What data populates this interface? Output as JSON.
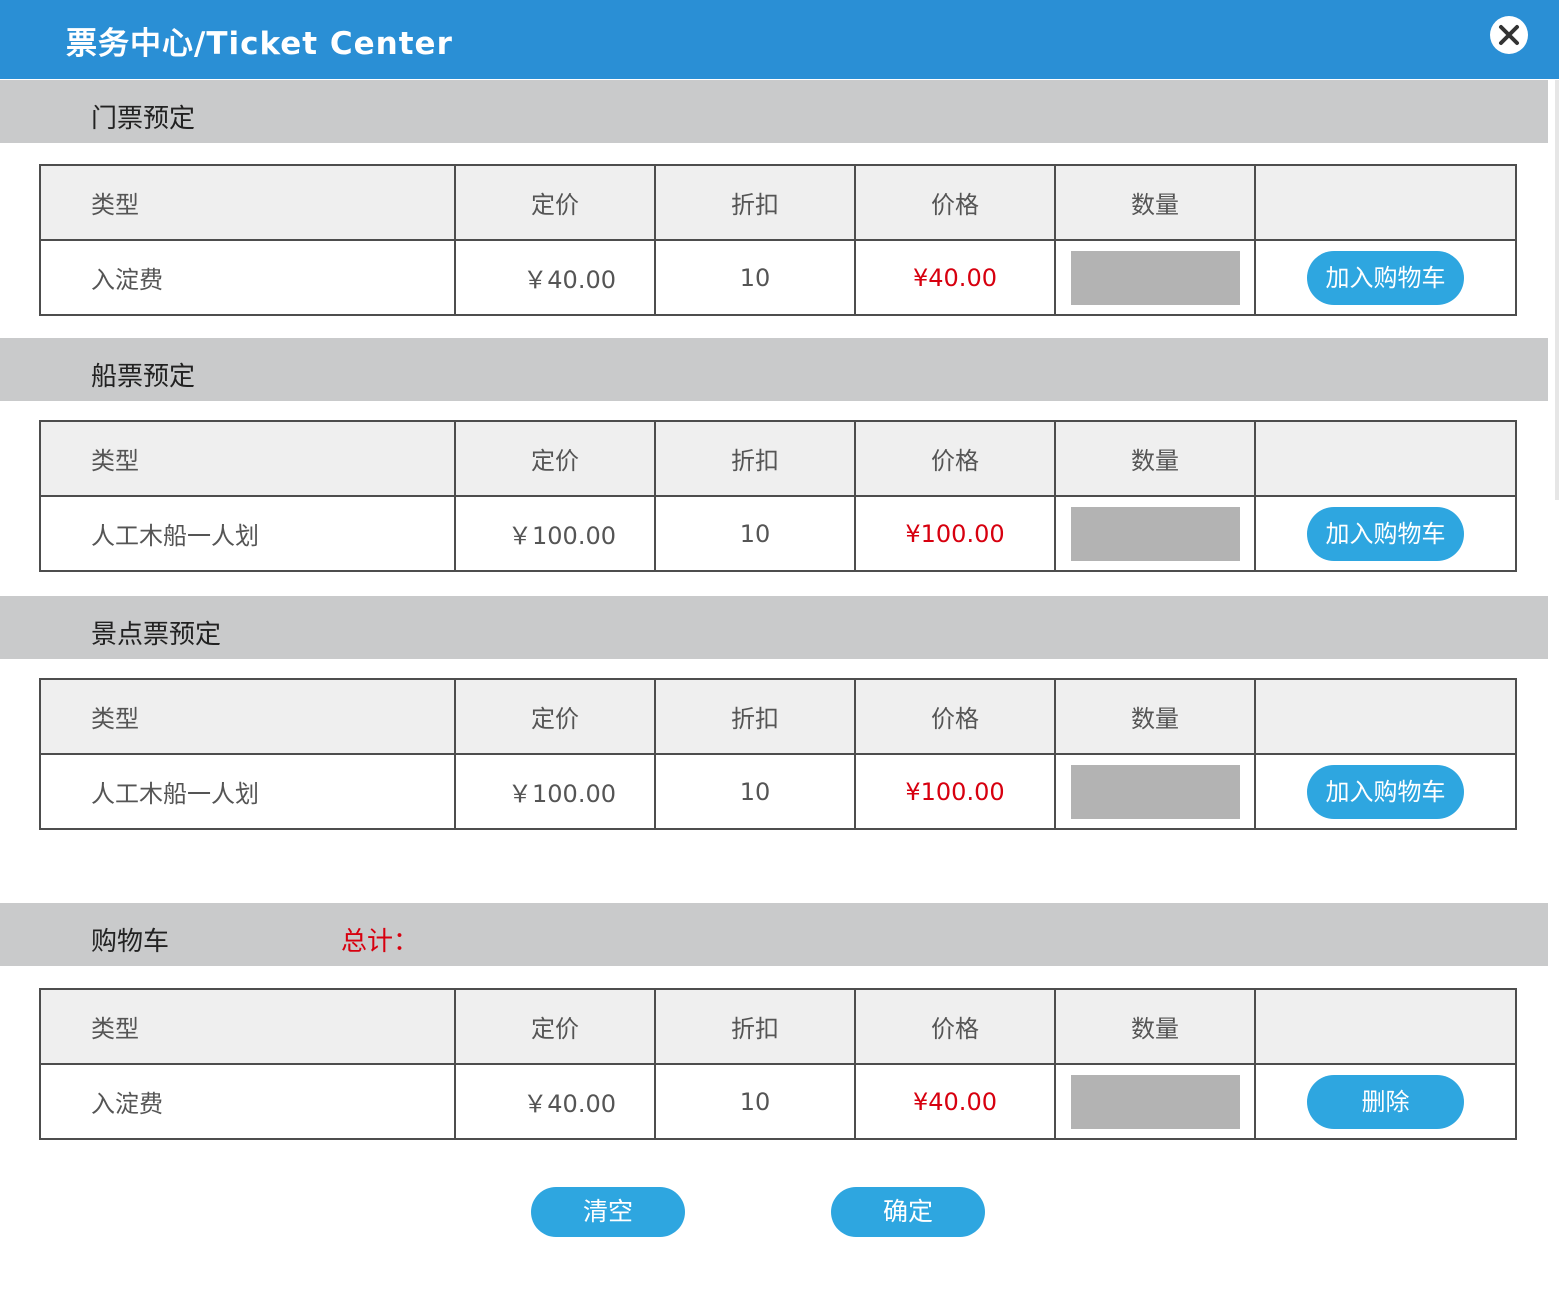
{
  "window": {
    "title": "票务中心/Ticket Center",
    "close_icon": "close-circle-x-icon"
  },
  "columns": {
    "type": "类型",
    "list_price": "定价",
    "discount": "折扣",
    "price": "价格",
    "quantity": "数量"
  },
  "sections": [
    {
      "title": "门票预定",
      "row": {
        "type": "入淀费",
        "list_price": "￥40.00",
        "discount": "10",
        "price": "¥40.00",
        "action": "加入购物车"
      }
    },
    {
      "title": "船票预定",
      "row": {
        "type": "人工木船一人划",
        "list_price": "￥100.00",
        "discount": "10",
        "price": "¥100.00",
        "action": "加入购物车"
      }
    },
    {
      "title": "景点票预定",
      "row": {
        "type": "人工木船一人划",
        "list_price": "￥100.00",
        "discount": "10",
        "price": "¥100.00",
        "action": "加入购物车"
      }
    }
  ],
  "cart": {
    "title": "购物车",
    "total_label": "总计：",
    "row": {
      "type": "入淀费",
      "list_price": "￥40.00",
      "discount": "10",
      "price": "¥40.00",
      "action": "删除"
    }
  },
  "footer": {
    "clear_label": "清空",
    "confirm_label": "确定"
  },
  "colors": {
    "titlebar": "#2a8fd5",
    "section_header": "#c9cacb",
    "button": "#2ea6e0",
    "price_red": "#d7000f",
    "quantity_box": "#b3b3b3"
  }
}
